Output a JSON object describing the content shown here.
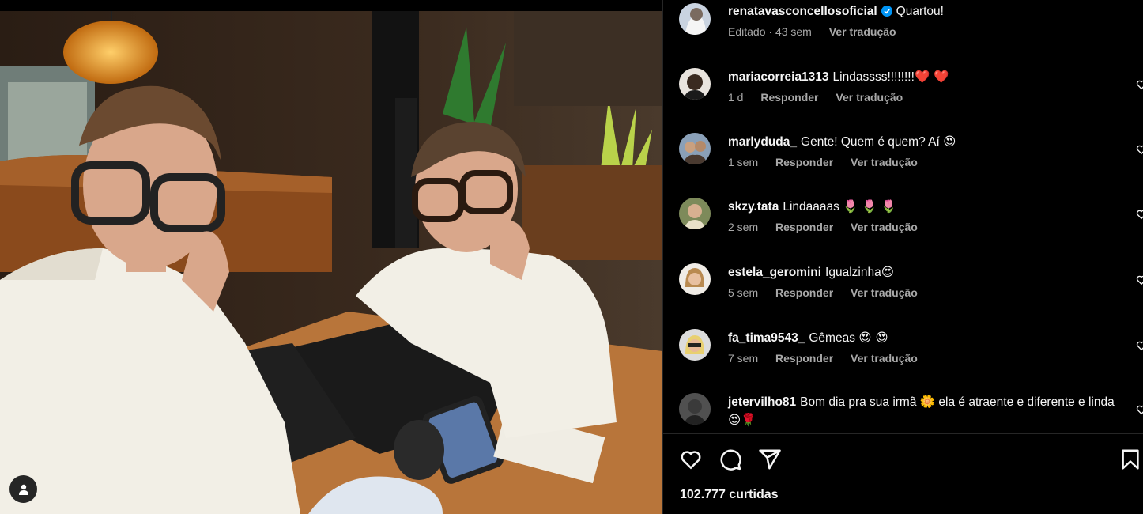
{
  "post": {
    "author": "renatavasconcellosoficial",
    "caption": "Quartou!",
    "edited_label": "Editado",
    "age": "43 sem",
    "translate_label": "Ver tradução"
  },
  "comments": [
    {
      "user": "mariacorreia1313",
      "text": "Lindassss!!!!!!!!",
      "emoji": "❤️ ❤️",
      "age": "1 d",
      "reply": "Responder",
      "translate": "Ver tradução"
    },
    {
      "user": "marlyduda_",
      "text": "Gente! Quem é quem? Aí",
      "emoji": "😍",
      "age": "1 sem",
      "reply": "Responder",
      "translate": "Ver tradução"
    },
    {
      "user": "skzy.tata",
      "text": "Lindaaaas",
      "emoji": "🌷 🌷 🌷",
      "age": "2 sem",
      "reply": "Responder",
      "translate": "Ver tradução"
    },
    {
      "user": "estela_geromini",
      "text": "Igualzinha",
      "emoji": "😍",
      "age": "5 sem",
      "reply": "Responder",
      "translate": "Ver tradução"
    },
    {
      "user": "fa_tima9543_",
      "text": "Gêmeas",
      "emoji": "😍 😍",
      "age": "7 sem",
      "reply": "Responder",
      "translate": "Ver tradução"
    },
    {
      "user": "jetervilho81",
      "text": "Bom dia pra sua irmã",
      "emoji": "🌼",
      "text2": "ela é atraente e diferente e linda",
      "emoji2": "😍🌹"
    }
  ],
  "likes_label": "102.777 curtidas",
  "icons": [
    "like-icon",
    "comment-icon",
    "share-icon",
    "save-icon",
    "user-tag-icon",
    "verified-icon"
  ]
}
